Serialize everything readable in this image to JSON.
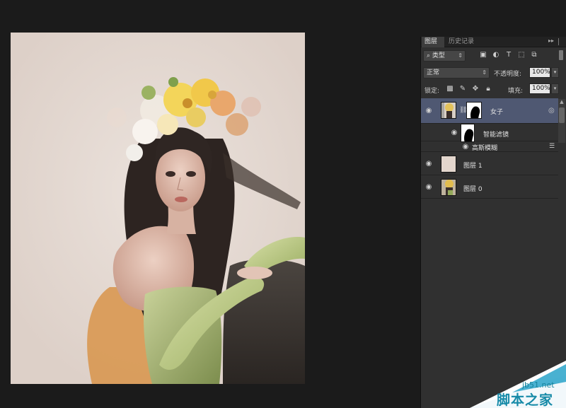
{
  "canvas": {
    "image_name": "woman-flower-crown-portrait"
  },
  "layers_panel": {
    "tabs": [
      "图层",
      "历史记录"
    ],
    "filter": {
      "label": "类型"
    },
    "blend_mode": "正常",
    "opacity_label": "不透明度:",
    "opacity_value": "100%",
    "lock_label": "锁定:",
    "fill_label": "填充:",
    "fill_value": "100%",
    "layers": [
      {
        "name": "女子",
        "selected": true,
        "has_mask": true,
        "smart_object": true
      },
      {
        "name": "智能滤镜",
        "sub": true
      },
      {
        "name": "高斯模糊",
        "sub": true
      },
      {
        "name": "图层 1"
      },
      {
        "name": "图层 0"
      }
    ]
  },
  "watermark": {
    "url": "jb51.net",
    "text": "脚本之家"
  },
  "colors": {
    "background": "#1b1b1b",
    "panel": "#303030",
    "selected_layer": "#4f5872",
    "canvas_bg": "#e4d9d2",
    "watermark": "#168aa8"
  }
}
